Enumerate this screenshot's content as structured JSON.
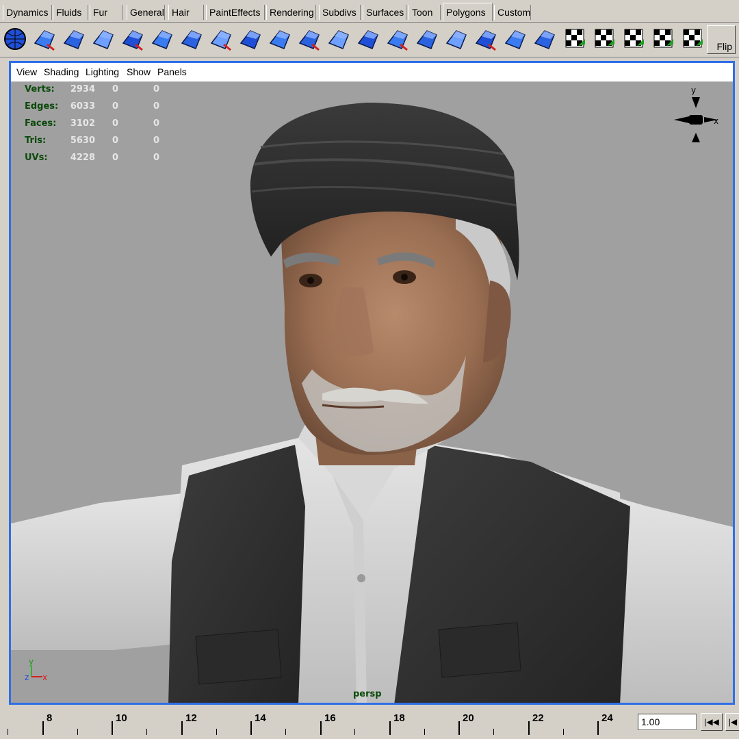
{
  "shelf_tabs": [
    {
      "label": "Dynamics",
      "active": false
    },
    {
      "label": "Fluids",
      "active": false
    },
    {
      "label": "Fur",
      "active": false
    },
    {
      "label": "General",
      "active": false
    },
    {
      "label": "Hair",
      "active": false
    },
    {
      "label": "PaintEffects",
      "active": false
    },
    {
      "label": "Rendering",
      "active": false
    },
    {
      "label": "Subdivs",
      "active": false
    },
    {
      "label": "Surfaces",
      "active": false
    },
    {
      "label": "Toon",
      "active": false
    },
    {
      "label": "Polygons",
      "active": true
    },
    {
      "label": "Custom",
      "active": false
    }
  ],
  "shelf_icons": [
    "polygon-sphere-icon",
    "combine-icon",
    "separate-icon",
    "extract-icon",
    "smooth-proxy-icon",
    "extrude-face-icon",
    "split-polygon-icon",
    "bevel-icon",
    "extrude-edge-icon",
    "append-polygon-icon",
    "merge-vertices-icon",
    "wedge-face-icon",
    "split-edge-ring-icon",
    "insert-edge-loop-icon",
    "poke-face-icon",
    "duplicate-face-icon",
    "planar-mapping-icon",
    "create-uvs-icon",
    "uv-checker-icon",
    "automatic-mapping-icon",
    "cylindrical-mapping-icon",
    "spherical-mapping-icon",
    "uv-editor-icon",
    "uv-layout-icon"
  ],
  "flip_label": "Flip",
  "panel_menu": [
    "View",
    "Shading",
    "Lighting",
    "Show",
    "Panels"
  ],
  "hud": [
    {
      "label": "Verts:",
      "values": [
        "2934",
        "0",
        "0"
      ]
    },
    {
      "label": "Edges:",
      "values": [
        "6033",
        "0",
        "0"
      ]
    },
    {
      "label": "Faces:",
      "values": [
        "3102",
        "0",
        "0"
      ]
    },
    {
      "label": "Tris:",
      "values": [
        "5630",
        "0",
        "0"
      ]
    },
    {
      "label": "UVs:",
      "values": [
        "4228",
        "0",
        "0"
      ]
    }
  ],
  "view_axes": {
    "y": "y",
    "x": "x"
  },
  "origin_axes": {
    "y": "y",
    "z": "z",
    "x": "x"
  },
  "camera_label": "persp",
  "time_slider": {
    "labels": [
      "8",
      "10",
      "12",
      "14",
      "16",
      "18",
      "20",
      "22",
      "24"
    ]
  },
  "current_time": "1.00",
  "colors": {
    "panel_border": "#2f6fe8",
    "viewport_bg": "#a0a0a0",
    "hud_label": "#0b4a0b",
    "hud_value": "#e6e6e6"
  }
}
